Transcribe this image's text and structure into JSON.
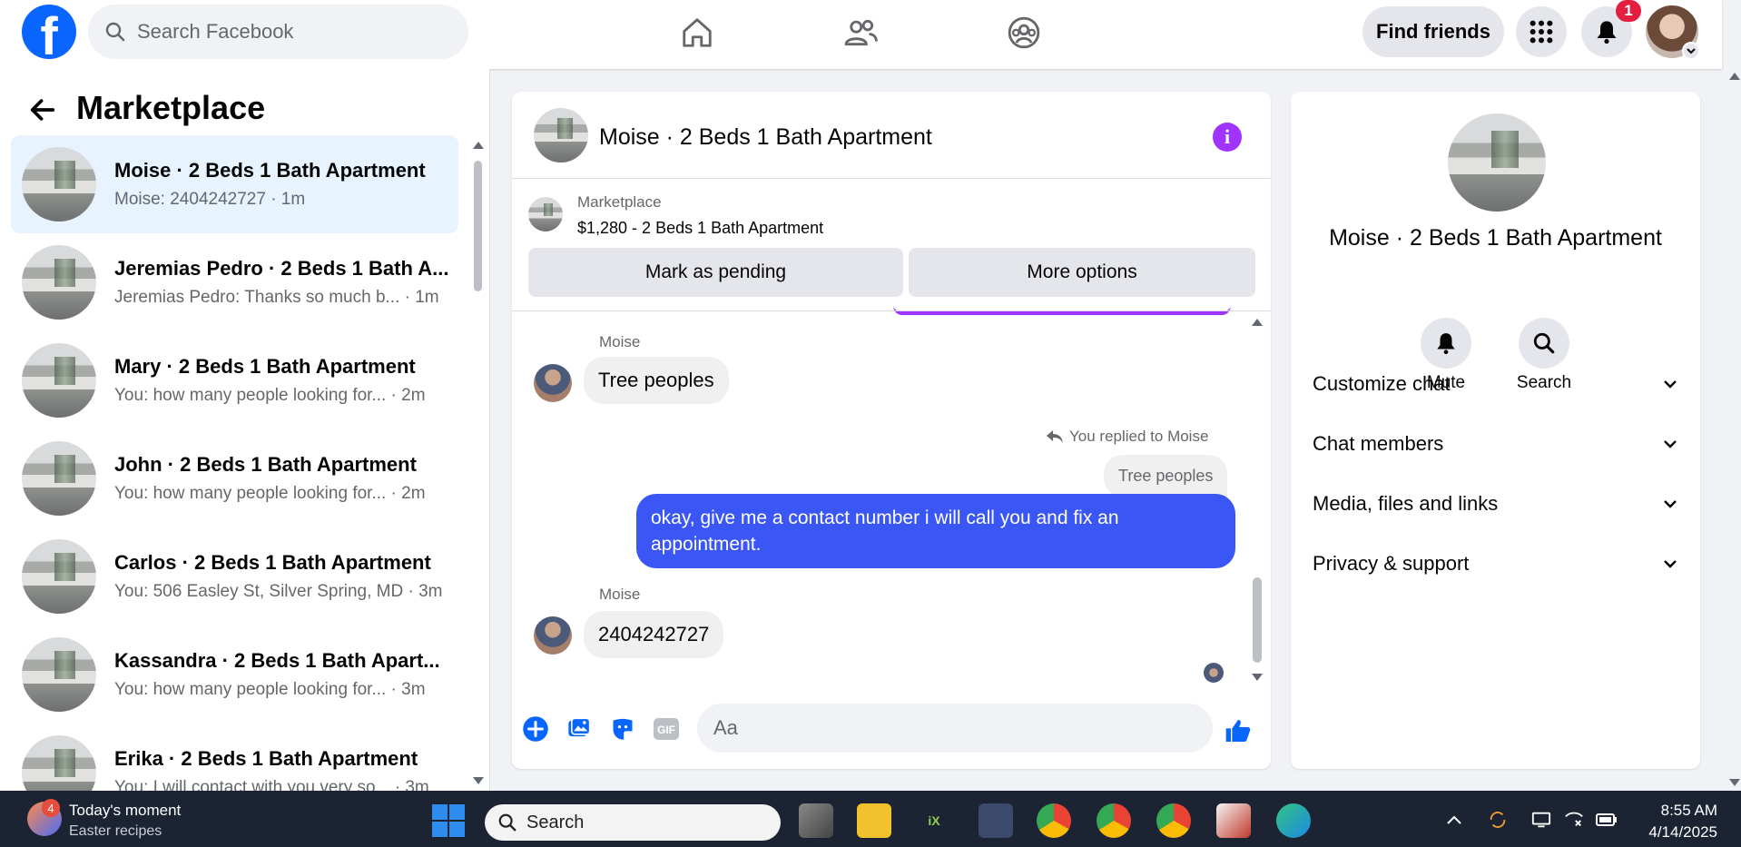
{
  "topbar": {
    "search_placeholder": "Search Facebook",
    "find_friends": "Find friends",
    "notification_count": "1",
    "logo_letter": "f"
  },
  "left": {
    "title": "Marketplace",
    "conversations": [
      {
        "name": "Moise · 2 Beds 1 Bath Apartment",
        "preview": "Moise: 2404242727 · 1m"
      },
      {
        "name": "Jeremias Pedro · 2 Beds 1 Bath A...",
        "preview": "Jeremias Pedro: Thanks so much b... · 1m"
      },
      {
        "name": "Mary · 2 Beds 1 Bath Apartment",
        "preview": "You: how many people looking for... · 2m"
      },
      {
        "name": "John · 2 Beds 1 Bath Apartment",
        "preview": "You: how many people looking for... · 2m"
      },
      {
        "name": "Carlos · 2 Beds 1 Bath Apartment",
        "preview": "You: 506 Easley St, Silver Spring, MD · 3m"
      },
      {
        "name": "Kassandra · 2 Beds 1 Bath Apart...",
        "preview": "You: how many people looking for... · 3m"
      },
      {
        "name": "Erika · 2 Beds 1 Bath Apartment",
        "preview": "You: I will contact with you very so... · 3m"
      }
    ]
  },
  "chat": {
    "title": "Moise · 2 Beds 1 Bath Apartment",
    "marketplace_label": "Marketplace",
    "listing": "$1,280 - 2 Beds 1 Bath Apartment",
    "mark_pending": "Mark as pending",
    "more_options": "More options",
    "messages": {
      "sender1": "Moise",
      "msg1": "Tree peoples",
      "reply_note": "You replied to Moise",
      "reply_quote": "Tree peoples",
      "msg2": "okay, give me a contact number i will call you and fix an appointment.",
      "sender2": "Moise",
      "msg3": "2404242727"
    },
    "input_placeholder": "Aa",
    "accent_color": "#3a57f5",
    "gif_label": "GIF"
  },
  "right": {
    "title": "Moise · 2 Beds 1 Bath Apartment",
    "mute": "Mute",
    "search": "Search",
    "sections": [
      "Customize chat",
      "Chat members",
      "Media, files and links",
      "Privacy & support"
    ]
  },
  "taskbar": {
    "moment_badge": "4",
    "moment_title": "Today's moment",
    "moment_sub": "Easter recipes",
    "search": "Search",
    "time": "8:55 AM",
    "date": "4/14/2025"
  }
}
